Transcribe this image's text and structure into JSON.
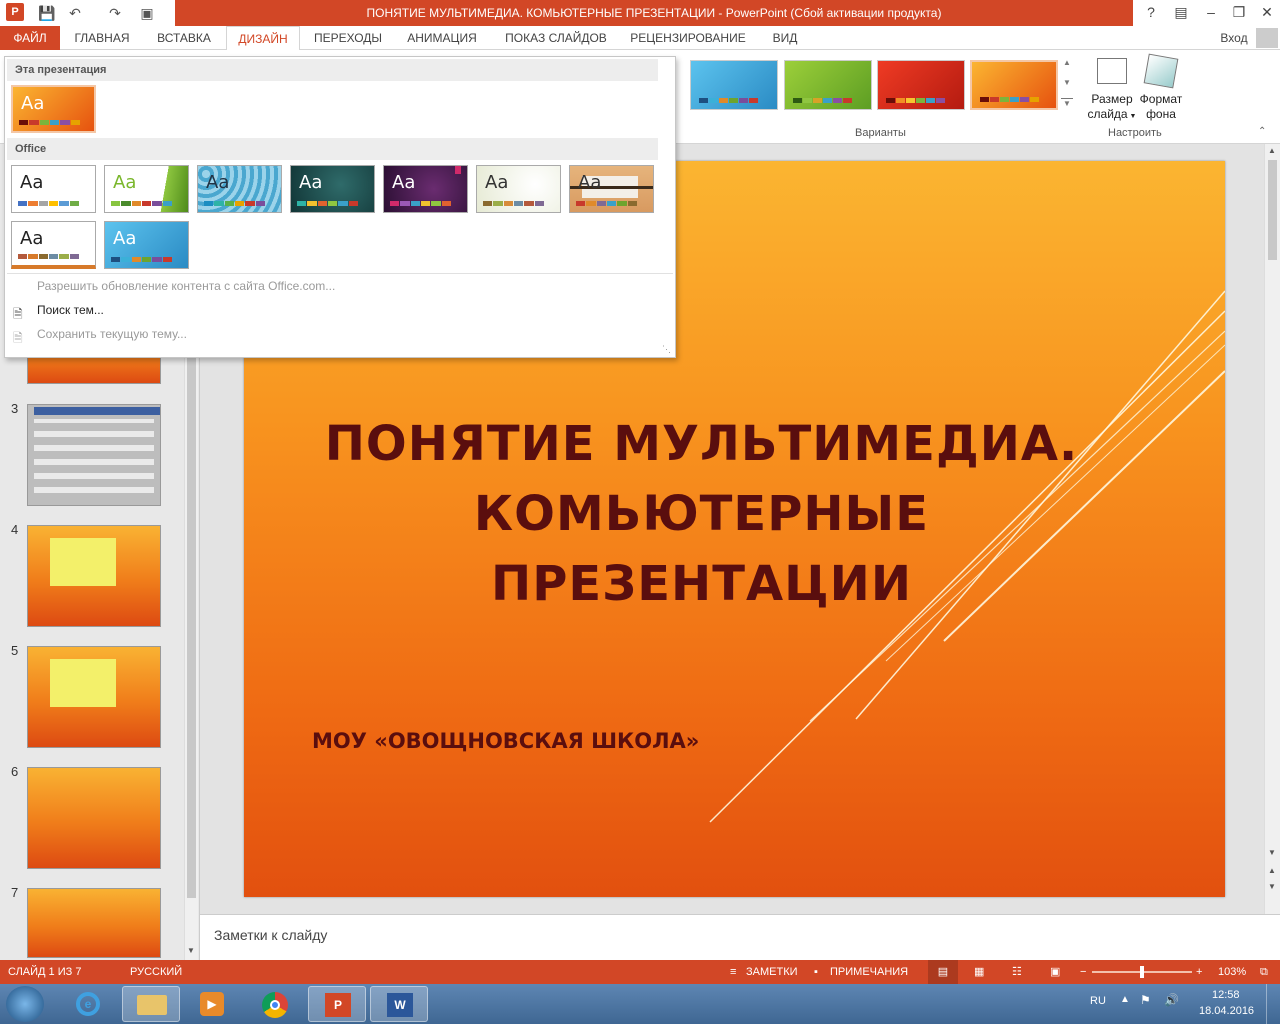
{
  "window": {
    "title": "ПОНЯТИЕ МУЛЬТИМЕДИА. КОМЬЮТЕРНЫЕ ПРЕЗЕНТАЦИИ -  PowerPoint (Сбой активации продукта)",
    "help": "?",
    "sign_in": "Вход"
  },
  "tabs": [
    "ФАЙЛ",
    "ГЛАВНАЯ",
    "ВСТАВКА",
    "ДИЗАЙН",
    "ПЕРЕХОДЫ",
    "АНИМАЦИЯ",
    "ПОКАЗ СЛАЙДОВ",
    "РЕЦЕНЗИРОВАНИЕ",
    "ВИД"
  ],
  "ribbon": {
    "variants_label": "Варианты",
    "customize_label": "Настроить",
    "slide_size": "Размер слайда",
    "slide_size_line1": "Размер",
    "slide_size_line2": "слайда",
    "format_bg_line1": "Формат",
    "format_bg_line2": "фона",
    "variant_colors": [
      "#3fa6d8",
      "#7ab72c",
      "#d42a1a",
      "#f08a20"
    ]
  },
  "gallery": {
    "this_presentation": "Эта презентация",
    "office": "Office",
    "aa": "Aa",
    "menu": {
      "allow_update": "Разрешить обновление контента с сайта Office.com...",
      "search_themes": "Поиск тем...",
      "save_theme": "Сохранить текущую тему..."
    }
  },
  "thumbnails": [
    "3",
    "4",
    "5",
    "6",
    "7"
  ],
  "slide": {
    "title_line1": "ПОНЯТИЕ МУЛЬТИМЕДИА.",
    "title_line2": "КОМЬЮТЕРНЫЕ",
    "title_line3": "ПРЕЗЕНТАЦИИ",
    "subtitle": "МОУ «ОВОЩНОВСКАЯ ШКОЛА»"
  },
  "notes_placeholder": "Заметки к слайду",
  "status": {
    "slide_of": "СЛАЙД 1 ИЗ 7",
    "language": "РУССКИЙ",
    "notes": "ЗАМЕТКИ",
    "comments": "ПРИМЕЧАНИЯ",
    "zoom": "103%"
  },
  "taskbar": {
    "lang": "RU",
    "time": "12:58",
    "date": "18.04.2016"
  }
}
